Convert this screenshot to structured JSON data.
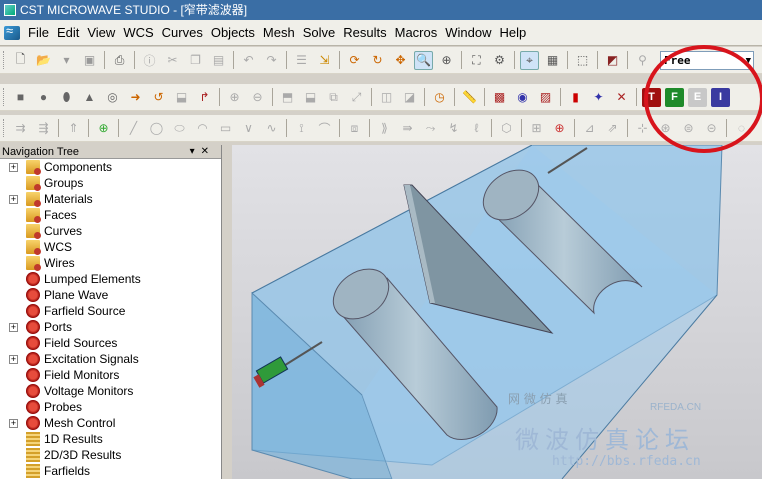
{
  "titlebar": {
    "title": "CST MICROWAVE STUDIO - [窄带滤波器]"
  },
  "menu": [
    "File",
    "Edit",
    "View",
    "WCS",
    "Curves",
    "Objects",
    "Mesh",
    "Solve",
    "Results",
    "Macros",
    "Window",
    "Help"
  ],
  "toolbar": {
    "mode_select": "Free"
  },
  "navigation": {
    "title": "Navigation Tree",
    "items": [
      {
        "label": "Components",
        "icon": "folder-icon",
        "expandable": true
      },
      {
        "label": "Groups",
        "icon": "folder-icon",
        "expandable": false
      },
      {
        "label": "Materials",
        "icon": "folder-icon",
        "expandable": true
      },
      {
        "label": "Faces",
        "icon": "folder-icon",
        "expandable": false
      },
      {
        "label": "Curves",
        "icon": "folder-icon",
        "expandable": false
      },
      {
        "label": "WCS",
        "icon": "folder-icon",
        "expandable": false
      },
      {
        "label": "Wires",
        "icon": "folder-icon",
        "expandable": false
      },
      {
        "label": "Lumped Elements",
        "icon": "gear-icon",
        "expandable": false
      },
      {
        "label": "Plane Wave",
        "icon": "gear-icon",
        "expandable": false
      },
      {
        "label": "Farfield Source",
        "icon": "gear-icon",
        "expandable": false
      },
      {
        "label": "Ports",
        "icon": "gear-icon",
        "expandable": true
      },
      {
        "label": "Field Sources",
        "icon": "gear-icon",
        "expandable": false
      },
      {
        "label": "Excitation Signals",
        "icon": "gear-icon",
        "expandable": true
      },
      {
        "label": "Field Monitors",
        "icon": "gear-icon",
        "expandable": false
      },
      {
        "label": "Voltage Monitors",
        "icon": "gear-icon",
        "expandable": false
      },
      {
        "label": "Probes",
        "icon": "gear-icon",
        "expandable": false
      },
      {
        "label": "Mesh Control",
        "icon": "gear-icon",
        "expandable": true
      },
      {
        "label": "1D Results",
        "icon": "results-icon",
        "expandable": false
      },
      {
        "label": "2D/3D Results",
        "icon": "results-icon",
        "expandable": false
      },
      {
        "label": "Farfields",
        "icon": "results-icon",
        "expandable": false
      }
    ]
  },
  "watermark": {
    "line1": "网 微 仿 真",
    "site": "RFEDA.CN",
    "forum": "微波仿真论坛",
    "url": "http://bbs.rfeda.cn"
  },
  "colors": {
    "title_bar": "#3a6ea5",
    "annotation": "#d8141c",
    "model_box": "#8fc3e8"
  }
}
